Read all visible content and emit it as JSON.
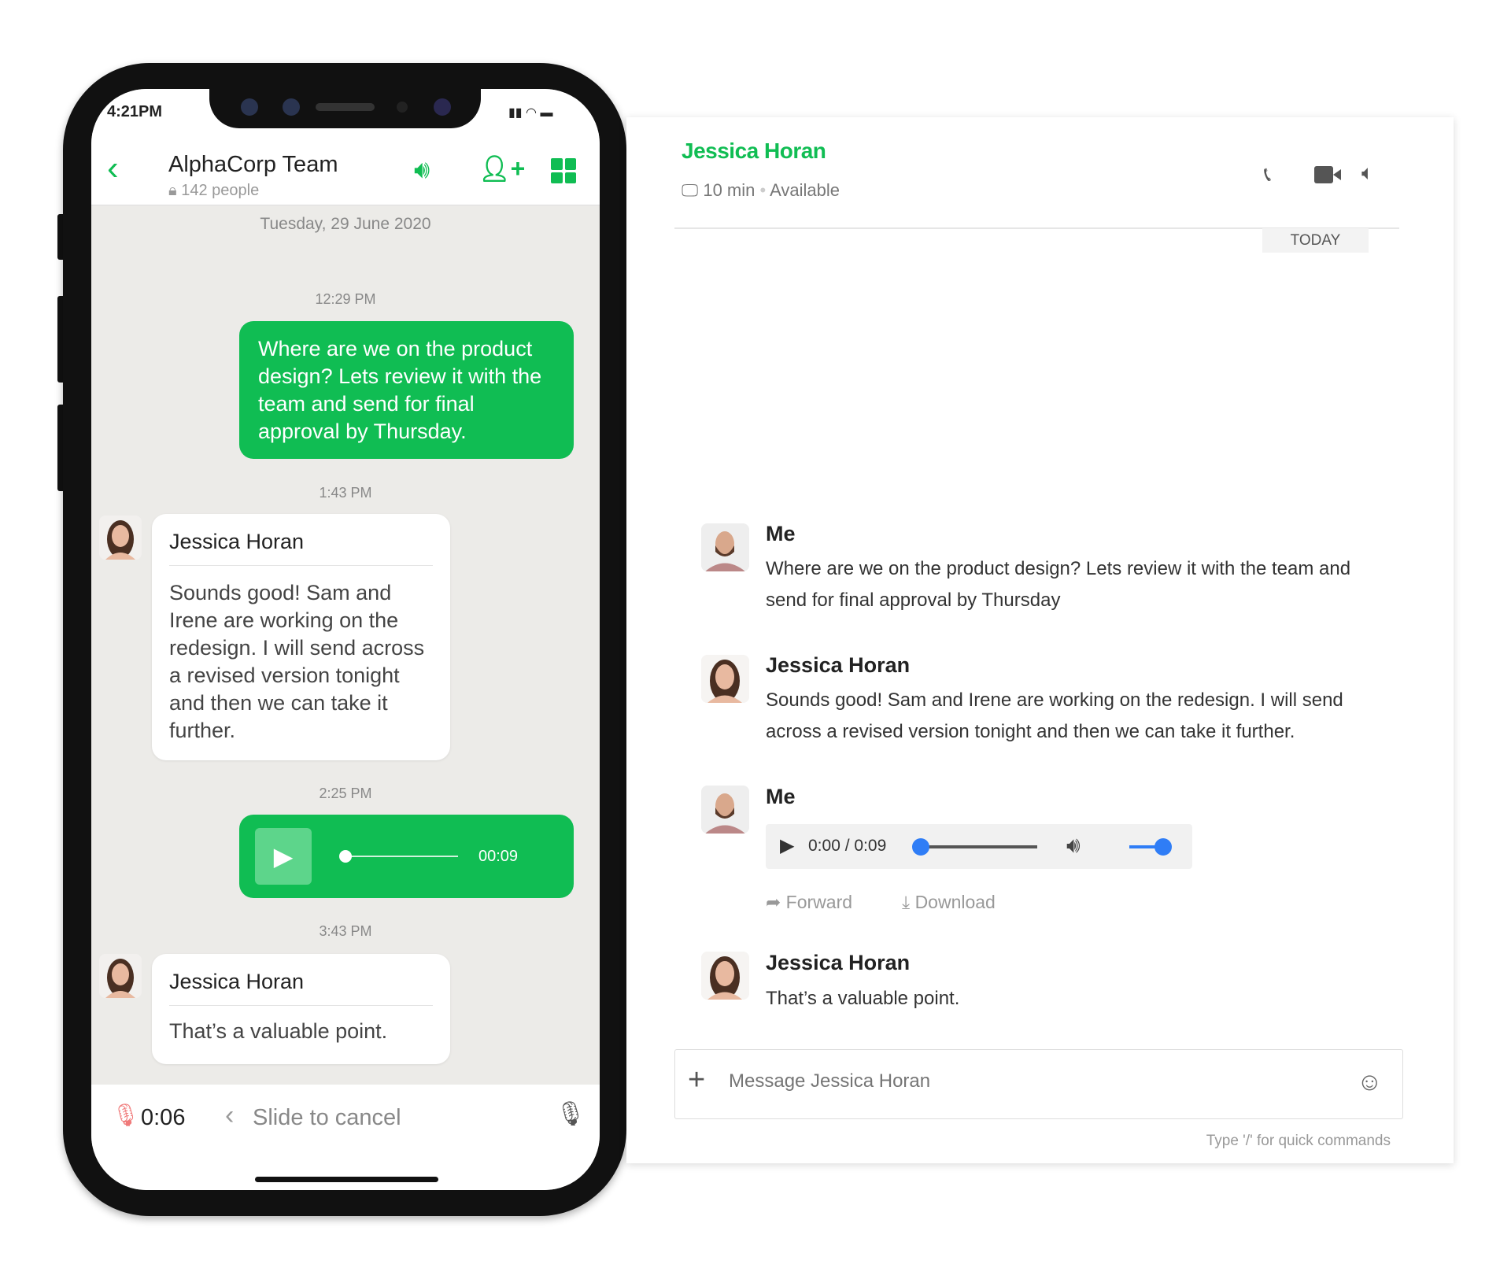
{
  "phone": {
    "status_time": "4:21PM",
    "header": {
      "title": "AlphaCorp Team",
      "members": "142 people"
    },
    "date": "Tuesday, 29 June 2020",
    "messages": [
      {
        "time": "12:29 PM",
        "text": "Where are we on the product design? Lets review it with the team and send for final approval by Thursday."
      },
      {
        "time": "1:43 PM",
        "sender": "Jessica Horan",
        "text": "Sounds good! Sam and Irene are working on the redesign. I will send across a revised version tonight and then we can take it further."
      },
      {
        "time": "2:25 PM",
        "duration": "00:09",
        "progress": 0
      },
      {
        "time": "3:43 PM",
        "sender": "Jessica Horan",
        "text": "That’s a valuable point."
      }
    ],
    "recorder": {
      "elapsed": "0:06",
      "cancel_hint": "Slide to cancel"
    }
  },
  "panel": {
    "contact": "Jessica Horan",
    "idle": "10 min",
    "status": "Available",
    "day_label": "TODAY",
    "messages": [
      {
        "sender": "Me",
        "text": "Where are we on the product design? Lets review it with the team and send for final approval by Thursday"
      },
      {
        "sender": "Jessica Horan",
        "text": "Sounds good! Sam and Irene are working on the redesign. I will send across a revised version tonight and then we can take it further."
      },
      {
        "sender": "Me",
        "audio": {
          "time": "0:00 / 0:09",
          "progress": 0,
          "volume": 1
        },
        "forward": "Forward",
        "download": "Download"
      },
      {
        "sender": "Jessica Horan",
        "text": "That’s a valuable point."
      }
    ],
    "input_placeholder": "Message Jessica Horan",
    "hint": "Type '/' for quick commands"
  },
  "colors": {
    "green": "#10bd53",
    "blue": "#2f7df6"
  }
}
